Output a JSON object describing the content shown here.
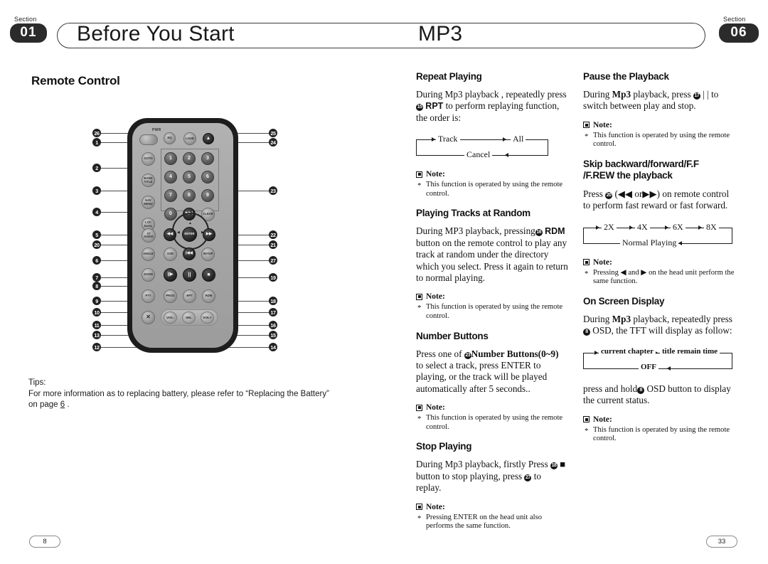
{
  "header": {
    "section_label_left": "Section",
    "section_number_left": "01",
    "title_left": "Before You Start",
    "title_right": "MP3",
    "section_label_right": "Section",
    "section_number_right": "06"
  },
  "left_column": {
    "heading": "Remote Control",
    "tips": {
      "label": "Tips:",
      "line1": "For more information as to replacing battery, please refer to  “Replacing the Battery”",
      "line2_pre": "on page ",
      "page_ref": "6",
      "line2_post": " ."
    },
    "remote": {
      "power_label": "PWR",
      "buttons": [
        {
          "key": "pwr",
          "label": ""
        },
        {
          "key": "eq",
          "label": "EQ"
        },
        {
          "key": "loud",
          "label": "LOUD"
        },
        {
          "key": "eject",
          "label": "▲"
        },
        {
          "key": "goto",
          "label": "GOTO"
        },
        {
          "key": "band",
          "label": "BAND\nTITLE"
        },
        {
          "key": "nav",
          "label": "NAV\nMENU"
        },
        {
          "key": "loc",
          "label": "LOC\nDUAL"
        },
        {
          "key": "n1",
          "label": "1"
        },
        {
          "key": "n2",
          "label": "2"
        },
        {
          "key": "n3",
          "label": "3"
        },
        {
          "key": "n4",
          "label": "4"
        },
        {
          "key": "n5",
          "label": "5"
        },
        {
          "key": "n6",
          "label": "6"
        },
        {
          "key": "n7",
          "label": "7"
        },
        {
          "key": "n8",
          "label": "8"
        },
        {
          "key": "n9",
          "label": "9"
        },
        {
          "key": "n0",
          "label": "0"
        },
        {
          "key": "next",
          "label": "▶▶|"
        },
        {
          "key": "clear",
          "label": "CLEAR"
        },
        {
          "key": "staudio",
          "label": "ST\nAUDIO"
        },
        {
          "key": "frew",
          "label": "◀◀"
        },
        {
          "key": "enter",
          "label": "ENTER"
        },
        {
          "key": "ffwd",
          "label": "▶▶"
        },
        {
          "key": "prev",
          "label": "|◀◀"
        },
        {
          "key": "angle",
          "label": "ANGLE"
        },
        {
          "key": "osd",
          "label": "OSD"
        },
        {
          "key": "setup",
          "label": "SETUP"
        },
        {
          "key": "zoom",
          "label": "ZOOM"
        },
        {
          "key": "slow",
          "label": "||▶"
        },
        {
          "key": "pause",
          "label": "||"
        },
        {
          "key": "stop",
          "label": "■"
        },
        {
          "key": "ptv",
          "label": "PTY"
        },
        {
          "key": "prog",
          "label": "PROG"
        },
        {
          "key": "rpt",
          "label": "RPT"
        },
        {
          "key": "rdm",
          "label": "RDM"
        },
        {
          "key": "mute",
          "label": "✕"
        },
        {
          "key": "volminus",
          "label": "VOL-"
        },
        {
          "key": "sel",
          "label": "SEL"
        },
        {
          "key": "volplus",
          "label": "VOL+"
        }
      ],
      "callouts_left": [
        "26",
        "1",
        "2",
        "3",
        "4",
        "5",
        "20",
        "6",
        "7",
        "8",
        "9",
        "10",
        "11",
        "13",
        "12"
      ],
      "callouts_right": [
        "25",
        "24",
        "23",
        "22",
        "21",
        "27",
        "19",
        "18",
        "17",
        "16",
        "15",
        "14"
      ]
    }
  },
  "mid_column": [
    {
      "id": "repeat-playing",
      "heading": "Repeat Playing",
      "para_parts": {
        "t1": "During Mp3 playback , repeatedly press ",
        "num": "15",
        "bold": "RPT",
        "t2": " to perform replaying function, the order is:"
      },
      "flow": {
        "type": "loop",
        "nodes": [
          "Track",
          "All",
          "Cancel"
        ]
      },
      "note_label": "Note:",
      "note_text": "This function is operated by using the remote control."
    },
    {
      "id": "playing-tracks-at-random",
      "heading": "Playing Tracks at Random",
      "para_parts": {
        "t1": "During MP3 playback, pressing",
        "num": "16",
        "bold": "RDM",
        "t2": " button on the remote control to play any track at random under the directory which you select. Press it again to return to normal playing."
      },
      "note_label": "Note:",
      "note_text": "This function is operated by using the remote control."
    },
    {
      "id": "number-buttons",
      "heading": "Number Buttons",
      "para_parts": {
        "t1": "Press one of ",
        "num": "23",
        "bold": "Number Buttons(0~9)",
        "t2": " to select a track, press ENTER to playing, or the track will be played automatically after 5 seconds.."
      },
      "note_label": "Note:",
      "note_text": "This function is operated by using the remote control."
    },
    {
      "id": "stop-playing",
      "heading": "Stop Playing",
      "para_parts": {
        "t1": "During Mp3 playback, firstly Press ",
        "num": "18",
        "bold": "■",
        "t2": " button to stop playing, press ",
        "num2": "27",
        "t3": " to replay."
      },
      "note_label": "Note:",
      "note_text": "Pressing ENTER on the head unit also performs the same function."
    }
  ],
  "right_column": [
    {
      "id": "pause-the-playback",
      "heading": "Pause the Playback",
      "para_parts": {
        "t1": "During ",
        "bold1": "Mp3",
        "t2": " playback, press ",
        "num": "17",
        "t3": " | |  to switch between play and stop."
      },
      "note_label": "Note:",
      "note_text": "This function is operated by using the remote control."
    },
    {
      "id": "skip-backward-forward",
      "heading_line1": "Skip backward/forward/F.F",
      "heading_line2": "/F.REW the playback",
      "para_parts": {
        "t1": "Press ",
        "num": "20",
        "t2": " (◀◀ or▶▶) on remote control to perform fast reward or fast forward."
      },
      "flow": {
        "type": "speed-loop",
        "nodes": [
          "2X",
          "4X",
          "6X",
          "8X"
        ],
        "return_node": "Normal Playing"
      },
      "note_label": "Note:",
      "note_text": "Pressing ◀ and ▶ on the head unit perform the same function."
    },
    {
      "id": "on-screen-display",
      "heading": "On Screen Display",
      "para_parts": {
        "t1": "During ",
        "bold1": "Mp3",
        "t2": " playback, repeatedly press ",
        "num": "8",
        "t3": " OSD, the TFT will display as follow:"
      },
      "flow": {
        "type": "loop",
        "nodes": [
          "current chapter",
          "title remain time",
          "OFF"
        ]
      },
      "para2_parts": {
        "t1": "press and hold",
        "num": "8",
        "t2": " OSD button to display the current status."
      },
      "note_label": "Note:",
      "note_text": "This function is operated by using the remote control."
    }
  ],
  "footer": {
    "page_left": "8",
    "page_right": "33"
  },
  "colors": {
    "ink": "#111111",
    "pill_bg": "#2b2b2b",
    "rule": "#3a3a3a"
  }
}
